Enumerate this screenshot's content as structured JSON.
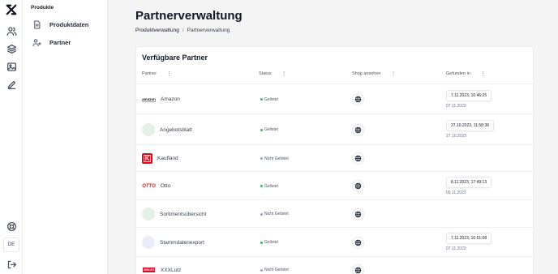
{
  "nav": {
    "rail_icons": [
      "logo-icon",
      "users-icon",
      "layers-icon",
      "image-icon",
      "pen-icon",
      "support-icon",
      "logout-icon"
    ],
    "language": "DE"
  },
  "subnav": {
    "heading": "Produkte",
    "items": [
      {
        "label": "Produktdaten",
        "icon": "document-icon"
      },
      {
        "label": "Partner",
        "icon": "users-plus-icon"
      }
    ]
  },
  "page": {
    "title": "Partnerverwaltung",
    "breadcrumb": [
      "Produktverwaltung",
      "/",
      "Partnerverwaltung"
    ]
  },
  "card": {
    "title": "Verfügbare Partner",
    "columns": [
      "Partner",
      "Status",
      "Shop ansehen",
      "Gefunden in"
    ],
    "rows": [
      {
        "name": "Amazon",
        "logo": "amazon",
        "logo_text": "amazon",
        "status": "Gelistet",
        "found_chip": "7.11.2023, 10:46:25",
        "found_sub": "07.11.2023"
      },
      {
        "name": "Angebotsblatt",
        "logo": "placeholder",
        "logo_text": "",
        "status": "Gelistet",
        "found_chip": "27.10.2023, 11:58:38",
        "found_sub": "27.10.2023"
      },
      {
        "name": "Kaufland",
        "logo": "kaufland",
        "logo_text": "K",
        "status": "Nicht Gelistet",
        "found_chip": "",
        "found_sub": ""
      },
      {
        "name": "Otto",
        "logo": "otto",
        "logo_text": "OTTO",
        "status": "Gelistet",
        "found_chip": "8.11.2023, 17:49:13",
        "found_sub": "09.11.2023"
      },
      {
        "name": "Sortimentsübersicht",
        "logo": "placeholder",
        "logo_text": "",
        "status": "Nicht Gelistet",
        "found_chip": "",
        "found_sub": ""
      },
      {
        "name": "Stammdatenexport",
        "logo": "placeholder-blue",
        "logo_text": "",
        "status": "Gelistet",
        "found_chip": "7.11.2023, 10:51:08",
        "found_sub": "07.11.2023"
      },
      {
        "name": "XXXLutz",
        "logo": "xxxlutz",
        "logo_text": "XXXLUTZ",
        "status": "Nicht Gelistet",
        "found_chip": "",
        "found_sub": ""
      }
    ]
  },
  "colors": {
    "listed": "#22c55e",
    "not_listed": "#9ca3af",
    "amazon_orange": "#f59e0b",
    "kaufland_red": "#e10915",
    "otto_red": "#d5201d"
  }
}
